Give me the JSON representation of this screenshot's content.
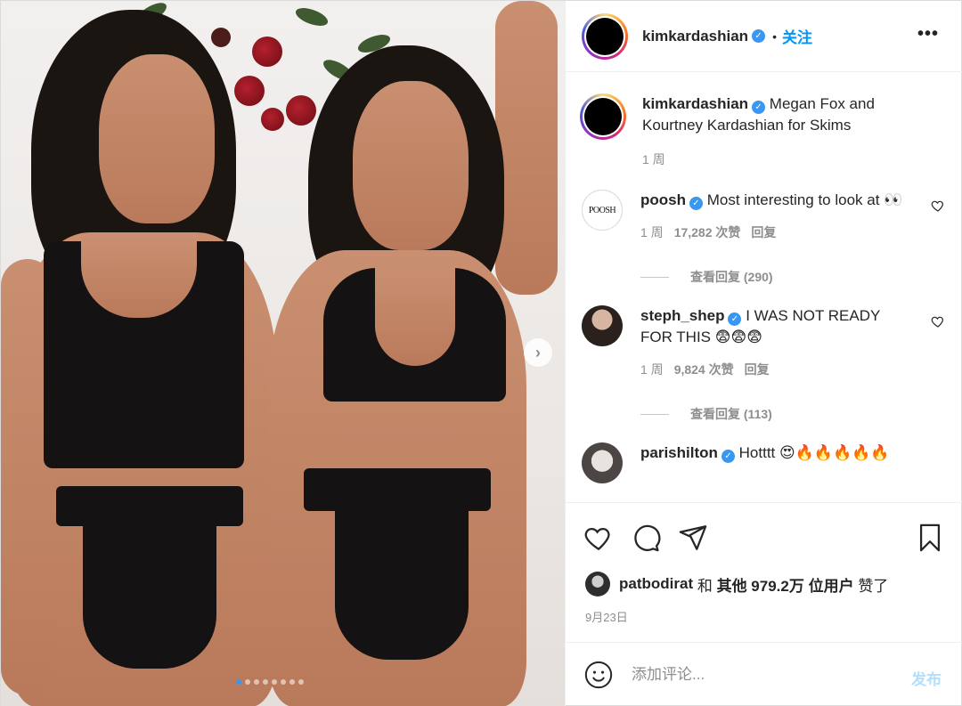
{
  "post": {
    "username": "kimkardashian",
    "verified_mark": "✓",
    "separator": "•",
    "follow_label": "关注",
    "more_label": "•••"
  },
  "caption": {
    "username": "kimkardashian",
    "text": "Megan Fox and Kourtney Kardashian for Skims",
    "time": "1 周"
  },
  "comments": [
    {
      "username": "poosh",
      "avatar_text": "POOSH",
      "text": "Most interesting to look at 👀",
      "time": "1 周",
      "likes": "17,282 次赞",
      "reply_label": "回复",
      "view_replies": "查看回复 (290)"
    },
    {
      "username": "steph_shep",
      "text": "I WAS NOT READY FOR THIS 😨😨😨",
      "time": "1 周",
      "likes": "9,824 次赞",
      "reply_label": "回复",
      "view_replies": "查看回复 (113)"
    },
    {
      "username": "parishilton",
      "text": "Hotttt 😍🔥🔥🔥🔥🔥"
    }
  ],
  "likes": {
    "first_user": "patbodirat",
    "and": "和",
    "others": "其他 979.2万 位用户",
    "suffix": "赞了"
  },
  "date": "9月23日",
  "add_comment": {
    "placeholder": "添加评论...",
    "post_label": "发布"
  },
  "carousel": {
    "slide_count": 8,
    "active_index": 0,
    "next_label": "›"
  },
  "colors": {
    "accent": "#0095f6",
    "verified": "#3897f0",
    "muted": "#8e8e8e",
    "post_disabled": "#b2dffc"
  }
}
